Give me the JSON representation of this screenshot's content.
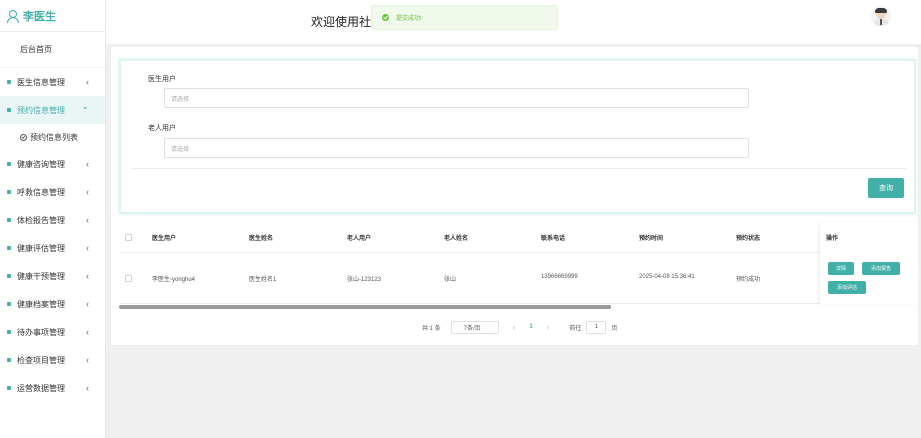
{
  "sidebar": {
    "user_name": "李医生",
    "home": "后台首页",
    "items": [
      {
        "label": "医生信息管理"
      },
      {
        "label": "预约信息管理"
      },
      {
        "label": "健康咨询管理"
      },
      {
        "label": "呼救信息管理"
      },
      {
        "label": "体检报告管理"
      },
      {
        "label": "健康评估管理"
      },
      {
        "label": "健康干预管理"
      },
      {
        "label": "健康档案管理"
      },
      {
        "label": "待办事项管理"
      },
      {
        "label": "检查项目管理"
      },
      {
        "label": "运营数据管理"
      }
    ],
    "sub_item": "预约信息列表",
    "chevron": "‹",
    "chevron_open": "⌄"
  },
  "header": {
    "welcome": "欢迎使用社区",
    "toast": "提交成功!"
  },
  "search": {
    "doctor_label": "医生用户",
    "doctor_placeholder": "请选择",
    "elder_label": "老人用户",
    "elder_placeholder": "请选择",
    "query_button": "查询"
  },
  "table": {
    "columns": [
      "医生用户",
      "医生姓名",
      "老人用户",
      "老人姓名",
      "联系电话",
      "预约时间",
      "预约状态",
      "操作"
    ],
    "rows": [
      {
        "doctor_user": "李医生-yonghu4",
        "doctor_name": "医生姓名1",
        "elder_user": "张山-123123",
        "elder_name": "张山",
        "phone": "13966669999",
        "time": "2025-04-08 15:36:41",
        "status": "预约成功",
        "actions": [
          "详情",
          "添加报告",
          "添加评估"
        ]
      }
    ]
  },
  "pagination": {
    "total": "共 1 条",
    "page_size": "7条/页",
    "prev": "‹",
    "current": "1",
    "next": "›",
    "goto": "前往",
    "goto_value": "1",
    "page_unit": "页"
  },
  "colors": {
    "accent": "#42b0a8",
    "toast_green": "#67c23a"
  }
}
